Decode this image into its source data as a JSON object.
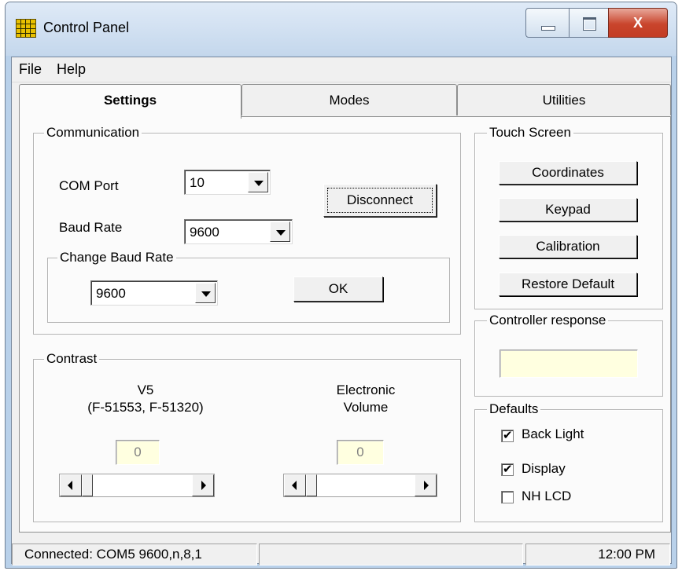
{
  "window": {
    "title": "Control Panel",
    "close_glyph": "X"
  },
  "menu": {
    "items": [
      "File",
      "Help"
    ]
  },
  "tabs": [
    "Settings",
    "Modes",
    "Utilities"
  ],
  "communication": {
    "label": "Communication",
    "com_port_label": "COM Port",
    "com_port_value": "10",
    "baud_rate_label": "Baud Rate",
    "baud_rate_value": "9600",
    "disconnect_label": "Disconnect",
    "change_baud": {
      "label": "Change Baud Rate",
      "value": "9600",
      "ok_label": "OK"
    }
  },
  "contrast": {
    "label": "Contrast",
    "v5_title": "V5",
    "v5_subtitle": "(F-51553, F-51320)",
    "v5_value": "0",
    "ev_title": "Electronic",
    "ev_subtitle": "Volume",
    "ev_value": "0"
  },
  "touch_screen": {
    "label": "Touch Screen",
    "buttons": [
      "Coordinates",
      "Keypad",
      "Calibration",
      "Restore Default"
    ]
  },
  "controller_response": {
    "label": "Controller response",
    "value": ""
  },
  "defaults": {
    "label": "Defaults",
    "items": [
      {
        "label": "Back Light",
        "checked": true
      },
      {
        "label": "Display",
        "checked": true
      },
      {
        "label": "NH LCD",
        "checked": false
      }
    ]
  },
  "status_bar": {
    "connection": "Connected: COM5 9600,n,8,1",
    "middle": "",
    "time": "12:00 PM"
  },
  "colors": {
    "readout_bg": "#ffffe0",
    "close_button": "#c9452c"
  }
}
